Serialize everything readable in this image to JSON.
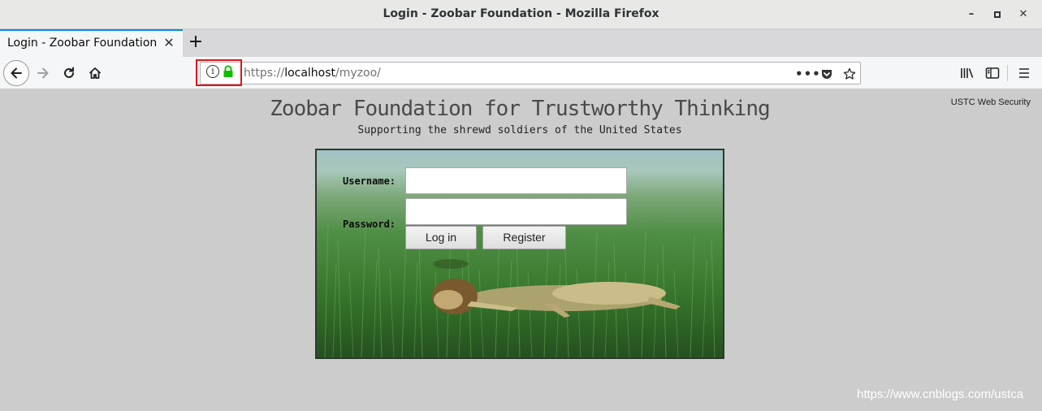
{
  "window": {
    "title": "Login - Zoobar Foundation - Mozilla Firefox"
  },
  "tab": {
    "label": "Login - Zoobar Foundation",
    "close_glyph": "✕"
  },
  "newtab_glyph": "+",
  "urlbar": {
    "scheme": "https://",
    "host": "localhost",
    "path": "/myzoo/",
    "info_glyph": "i"
  },
  "page": {
    "title": "Zoobar Foundation for Trustworthy Thinking",
    "subtitle": "Supporting the shrewd soldiers of the United States",
    "corner_note": "USTC Web Security"
  },
  "login": {
    "username_label": "Username:",
    "password_label": "Password:",
    "username_value": "",
    "password_value": "",
    "login_button": "Log in",
    "register_button": "Register"
  },
  "watermark": "https://www.cnblogs.com/ustca",
  "colors": {
    "tab_accent": "#0a84ff",
    "lock_green": "#12bc00",
    "highlight_box": "#e0141c"
  }
}
